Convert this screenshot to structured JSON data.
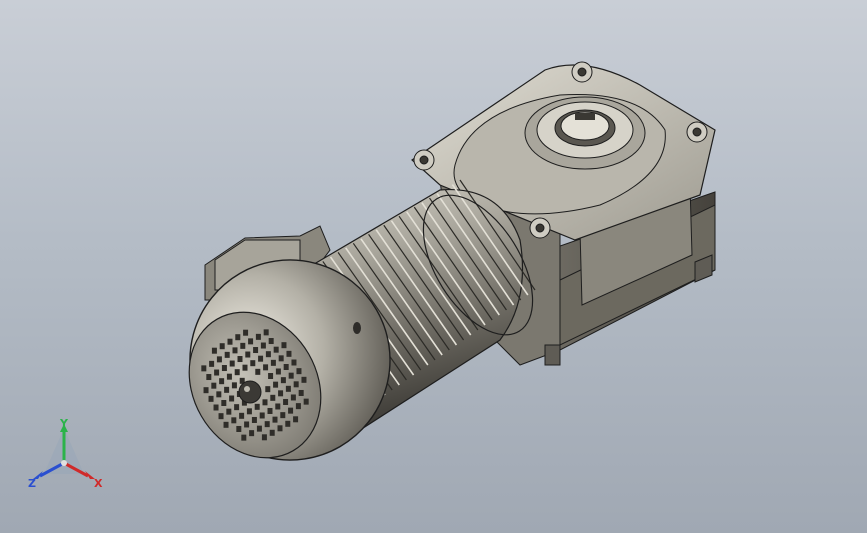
{
  "scene": {
    "background_top": "#c9ced6",
    "background_bottom": "#a0a8b3",
    "model_body_color": "#8d8a80",
    "model_highlight": "#d9d6cc",
    "model_shadow": "#4e4b44",
    "edge_color": "#1e1e1e"
  },
  "triad": {
    "x_label": "X",
    "y_label": "Y",
    "z_label": "Z",
    "x_color": "#d02a2a",
    "y_color": "#2bb34a",
    "z_color": "#2a4fd0"
  }
}
